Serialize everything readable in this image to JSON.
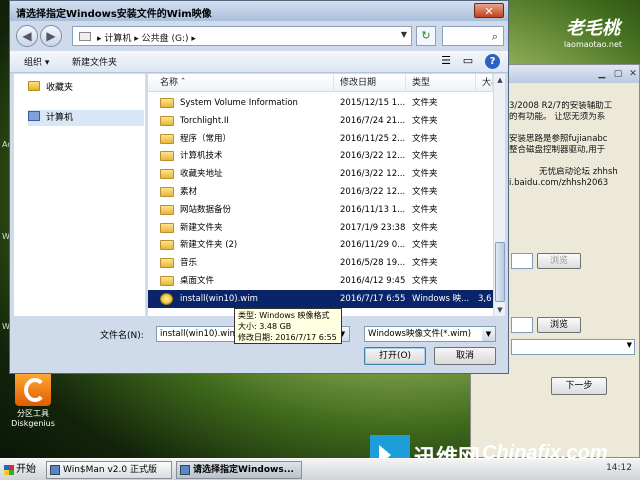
{
  "desktop": {
    "brand_title": "老毛桃",
    "brand_url": "laomaotao.net",
    "disk_icon_label1": "分区工具",
    "disk_icon_label2": "Diskgenius",
    "edge_text1": "Ad",
    "edge_text2": "Wi",
    "edge_text3": "Wi"
  },
  "back_window": {
    "lines": [
      "3/2008 R2/7的安装辅助工",
      "的有功能。 让您无须为系",
      "",
      "安装思路是参照fujianabc",
      "整合磁盘控制器驱动,用于",
      "",
      "无忧启动论坛 zhhsh",
      "i.baidu.com/zhhsh2063"
    ],
    "browse1": "浏览",
    "browse2": "浏览",
    "next": "下一步"
  },
  "dialog": {
    "title": "请选择指定Windows安装文件的Wim映像",
    "breadcrumb": "▸ 计算机 ▸ 公共盘 (G:) ▸",
    "toolbar": {
      "organize": "组织 ▾",
      "new_folder": "新建文件夹"
    },
    "nav": {
      "favorites": "收藏夹",
      "computer": "计算机"
    },
    "columns": {
      "name": "名称",
      "date": "修改日期",
      "type": "类型",
      "size": "大小"
    },
    "rows": [
      {
        "name": "System Volume Information",
        "date": "2015/12/15 1...",
        "type": "文件夹"
      },
      {
        "name": "Torchlight.II",
        "date": "2016/7/24 21...",
        "type": "文件夹"
      },
      {
        "name": "程序（常用）",
        "date": "2016/11/25 2...",
        "type": "文件夹"
      },
      {
        "name": "计算机技术",
        "date": "2016/3/22 12...",
        "type": "文件夹"
      },
      {
        "name": "收藏夹地址",
        "date": "2016/3/22 12...",
        "type": "文件夹"
      },
      {
        "name": "素材",
        "date": "2016/3/22 12...",
        "type": "文件夹"
      },
      {
        "name": "网站数据备份",
        "date": "2016/11/13 1...",
        "type": "文件夹"
      },
      {
        "name": "新建文件夹",
        "date": "2017/1/9 23:38",
        "type": "文件夹"
      },
      {
        "name": "新建文件夹 (2)",
        "date": "2016/11/29 0...",
        "type": "文件夹"
      },
      {
        "name": "音乐",
        "date": "2016/5/28 19...",
        "type": "文件夹"
      },
      {
        "name": "桌面文件",
        "date": "2016/4/12 9:45",
        "type": "文件夹"
      }
    ],
    "selected_row": {
      "name": "install(win10).wim",
      "date": "2016/7/17 6:55",
      "type": "Windows 映...",
      "size": "3,6"
    },
    "tooltip": {
      "type_line": "类型: Windows 映像格式",
      "size_line": "大小: 3.48 GB",
      "date_line": "修改日期: 2016/7/17 6:55"
    },
    "filename_label": "文件名(N):",
    "filename_value": "install(win10).wim",
    "filetype_value": "Windows映像文件(*.wim)",
    "open_button": "打开(O)",
    "cancel_button": "取消"
  },
  "watermark": {
    "cn": "迅维网",
    "en": "Chinafix.com"
  },
  "taskbar": {
    "start": "开始",
    "task1": "Win$Man v2.0 正式版",
    "task2": "请选择指定Windows...",
    "clock": "14:12"
  }
}
